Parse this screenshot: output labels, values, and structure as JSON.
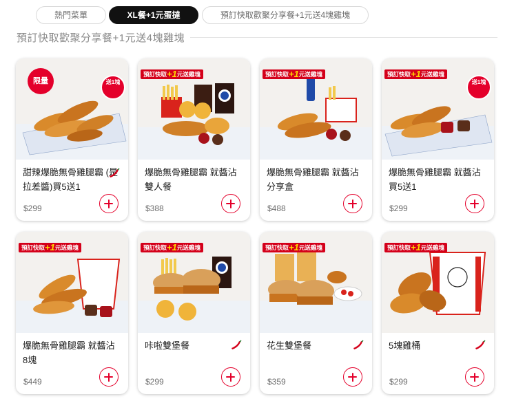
{
  "tabs": [
    {
      "label": "熱門菜單",
      "active": false
    },
    {
      "label": "XL餐+1元蛋撻",
      "active": true
    },
    {
      "label": "預訂快取歡聚分享餐+1元送4塊雞塊",
      "active": false
    }
  ],
  "section_title": "預訂快取歡聚分享餐+1元送4塊雞塊",
  "promo_tag": {
    "prefix": "預訂快取",
    "plus": "+1",
    "suffix": "元送雞塊"
  },
  "badge_limit": "限量",
  "badge_gift": "送1塊",
  "colors": {
    "brand_red": "#e4002b",
    "price_grey": "#6d6d6d",
    "active_tab": "#111111"
  },
  "products": [
    {
      "name": "甜辣爆脆無骨雞腿霸 (是拉差醬)買5送1",
      "price": "$299",
      "spicy": true,
      "promo": false
    },
    {
      "name": "爆脆無骨雞腿霸 就醬沾雙人餐",
      "price": "$388",
      "spicy": false,
      "promo": true
    },
    {
      "name": "爆脆無骨雞腿霸 就醬沾分享盒",
      "price": "$488",
      "spicy": false,
      "promo": true
    },
    {
      "name": "爆脆無骨雞腿霸 就醬沾 買5送1",
      "price": "$299",
      "spicy": false,
      "promo": true
    },
    {
      "name": "爆脆無骨雞腿霸 就醬沾 8塊",
      "price": "$449",
      "spicy": false,
      "promo": true
    },
    {
      "name": "咔啦雙堡餐",
      "price": "$299",
      "spicy": true,
      "promo": true
    },
    {
      "name": "花生雙堡餐",
      "price": "$359",
      "spicy": true,
      "promo": true
    },
    {
      "name": "5塊雞桶",
      "price": "$299",
      "spicy": true,
      "promo": true
    }
  ],
  "icons": {
    "add": "plus-circle-icon",
    "spicy": "chili-pepper-icon"
  }
}
